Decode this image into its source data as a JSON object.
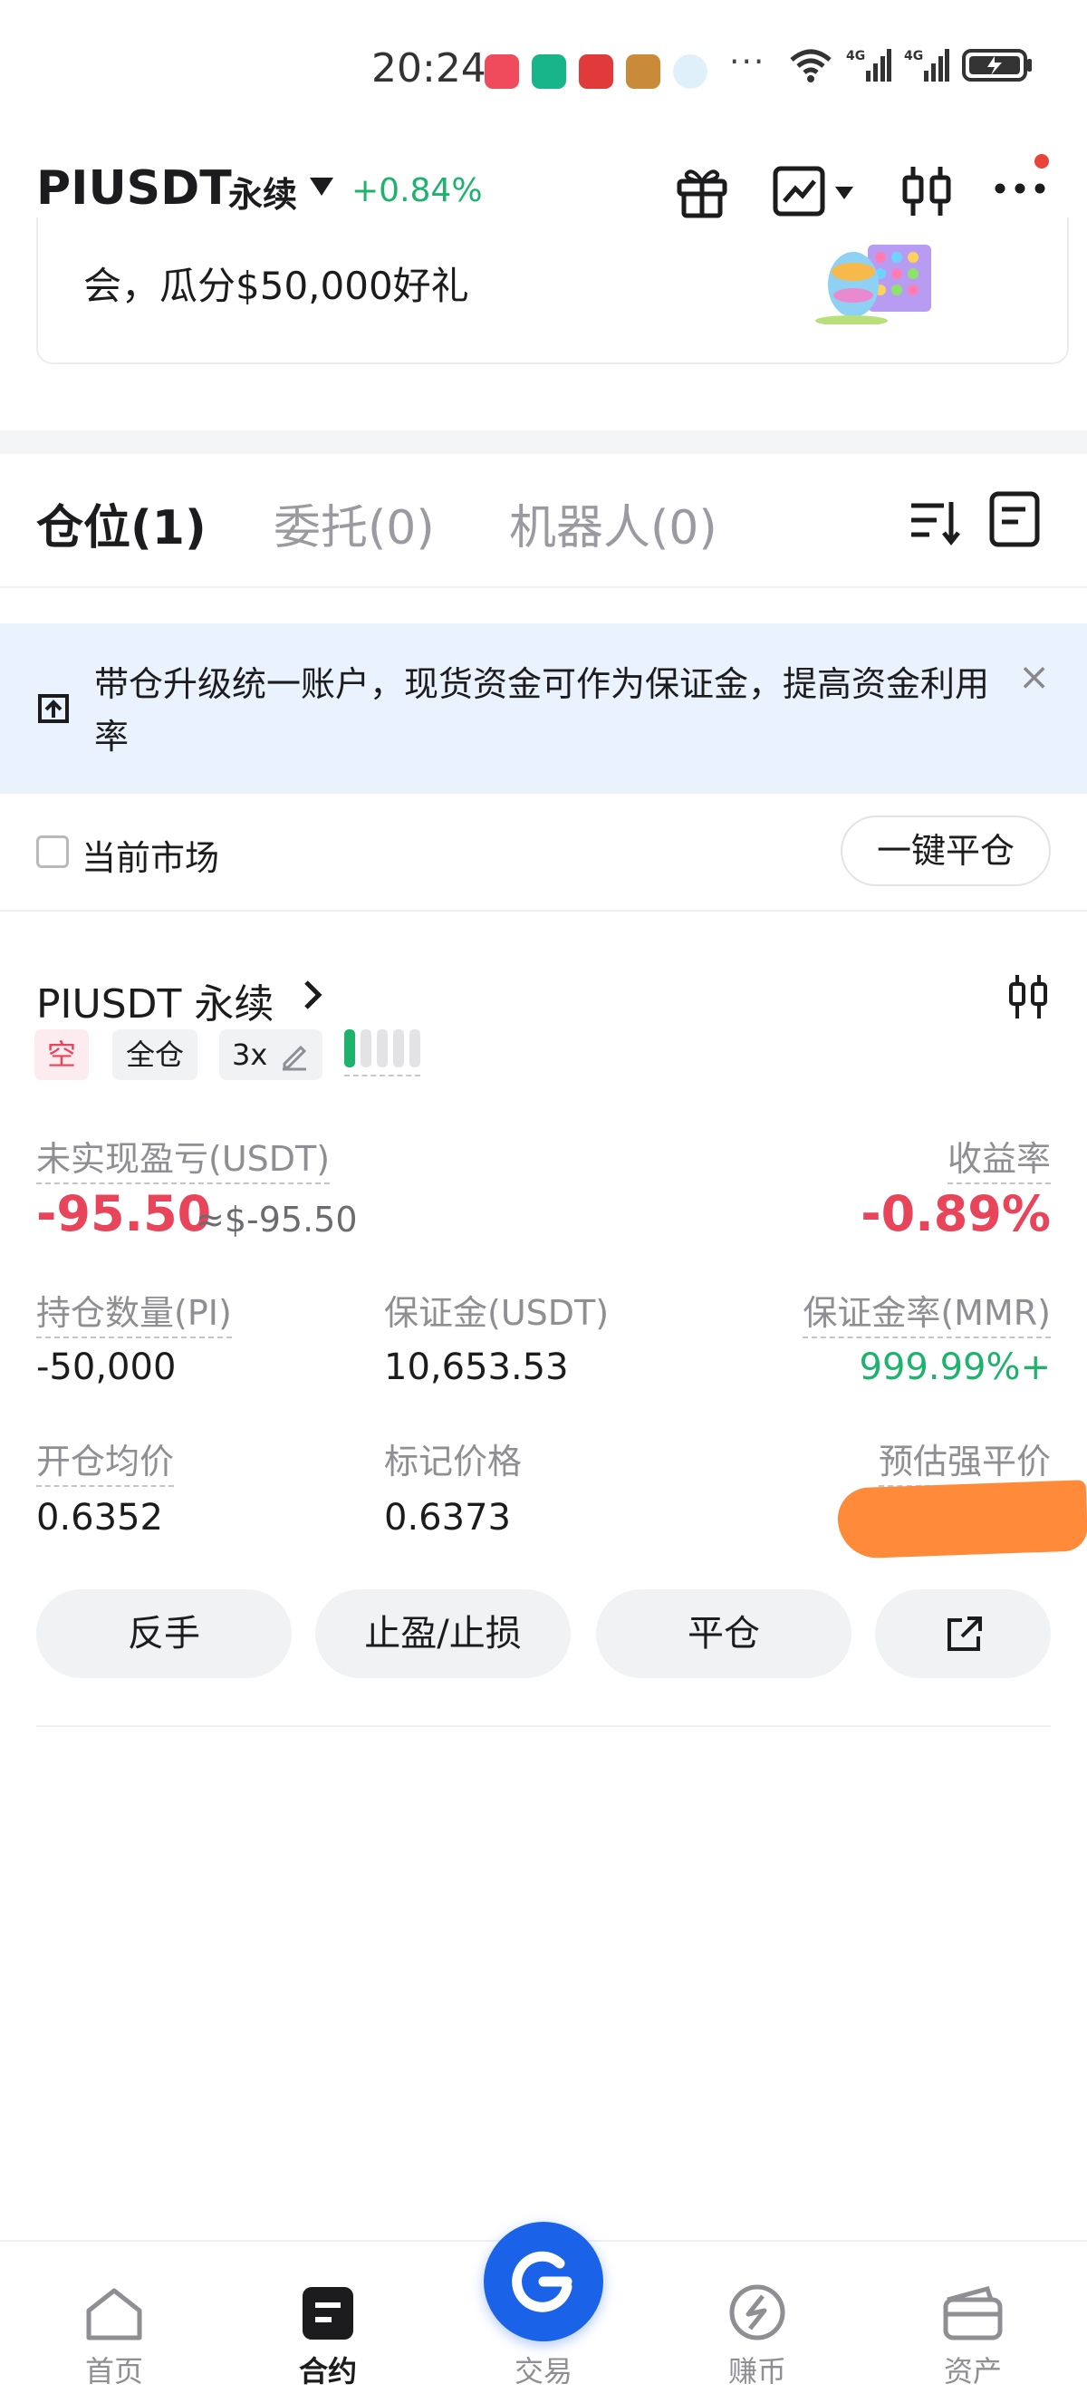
{
  "status_bar": {
    "time": "20:24",
    "more": "···"
  },
  "header": {
    "symbol": "PIUSDT",
    "contract_type": "永续",
    "change": "+0.84%"
  },
  "banner": {
    "text": "会，瓜分$50,000好礼"
  },
  "tabs": [
    {
      "label": "仓位(1)",
      "active": true
    },
    {
      "label": "委托(0)",
      "active": false
    },
    {
      "label": "机器人(0)",
      "active": false
    }
  ],
  "notice": {
    "text": "带仓升级统一账户，现货资金可作为保证金，提高资金利用率",
    "close": "×"
  },
  "filter": {
    "current_market_label": "当前市场",
    "close_all_label": "一键平仓"
  },
  "position": {
    "symbol": "PIUSDT 永续",
    "side_tag": "空",
    "margin_mode_tag": "全仓",
    "leverage_tag": "3x",
    "adl_level": 1,
    "unrealized_pnl_label": "未实现盈亏(USDT)",
    "unrealized_pnl": "-95.50",
    "unrealized_pnl_usd": "≈$-95.50",
    "roe_label": "收益率",
    "roe": "-0.89%",
    "size_label": "持仓数量(PI)",
    "size": "-50,000",
    "margin_label": "保证金(USDT)",
    "margin": "10,653.53",
    "mmr_label": "保证金率(MMR)",
    "mmr": "999.99%+",
    "entry_label": "开仓均价",
    "entry": "0.6352",
    "mark_label": "标记价格",
    "mark": "0.6373",
    "liq_label": "预估强平价"
  },
  "actions": {
    "reverse": "反手",
    "tpsl": "止盈/止损",
    "close": "平仓"
  },
  "nav": [
    {
      "label": "首页",
      "active": false
    },
    {
      "label": "合约",
      "active": true
    },
    {
      "label": "交易",
      "active": false
    },
    {
      "label": "赚币",
      "active": false
    },
    {
      "label": "资产",
      "active": false
    }
  ],
  "colors": {
    "up": "#1eb36d",
    "down": "#e8445a",
    "accent": "#1a63e8",
    "notice_bg": "#eaf3fd"
  }
}
